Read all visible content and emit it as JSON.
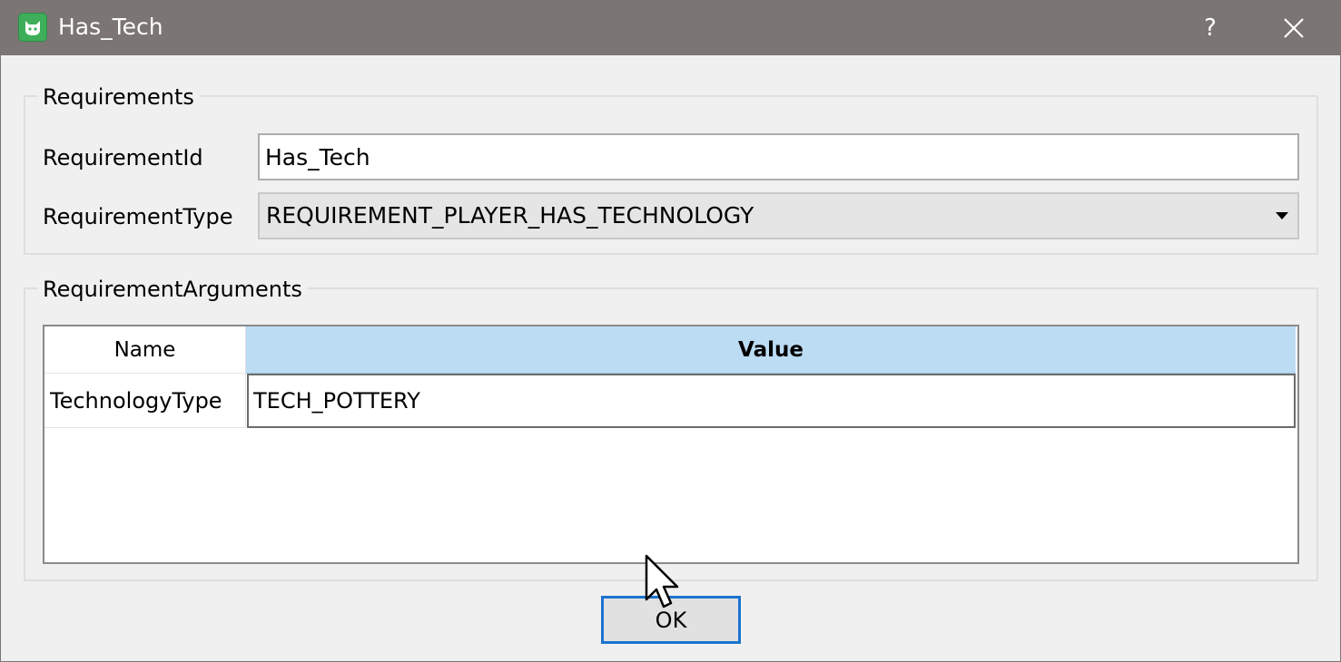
{
  "window": {
    "title": "Has_Tech",
    "help_label": "?",
    "icon": "app-cat-icon",
    "close_icon": "close-icon"
  },
  "requirements": {
    "group_title": "Requirements",
    "id_label": "RequirementId",
    "id_value": "Has_Tech",
    "type_label": "RequirementType",
    "type_value": "REQUIREMENT_PLAYER_HAS_TECHNOLOGY"
  },
  "arguments": {
    "group_title": "RequirementArguments",
    "columns": [
      "Name",
      "Value"
    ],
    "rows": [
      {
        "name": "TechnologyType",
        "value": "TECH_POTTERY"
      }
    ]
  },
  "buttons": {
    "ok_label": "OK"
  },
  "colors": {
    "titlebar": "#7b7574",
    "header_selected": "#bcdcf4",
    "focus_border": "#1a73cf"
  }
}
